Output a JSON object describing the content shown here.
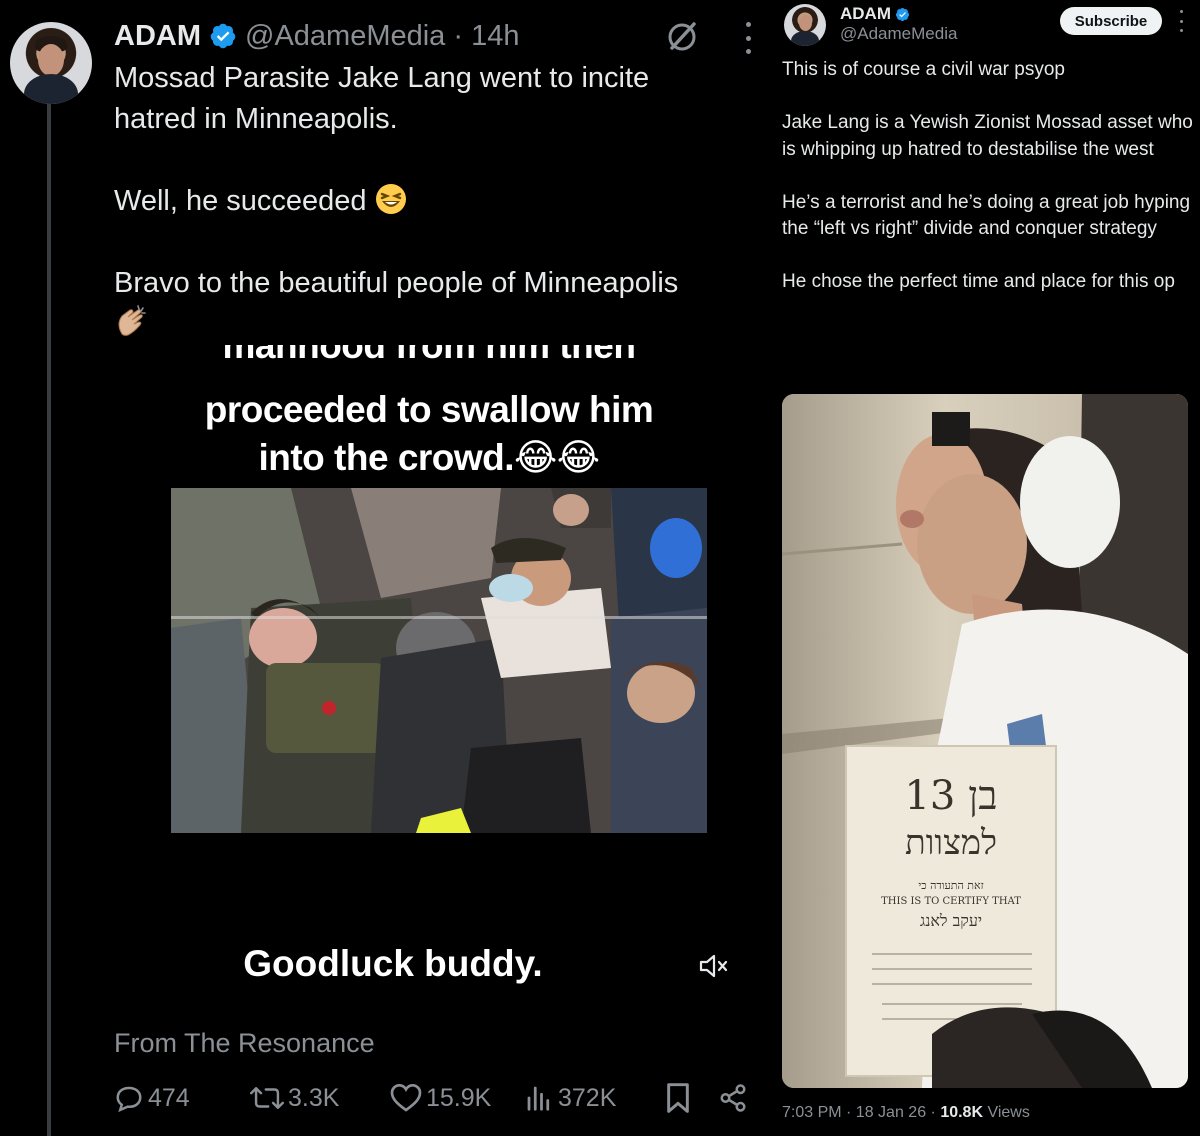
{
  "left_post": {
    "author_name": "ADAM",
    "handle_time": "@AdameMedia · 14h",
    "text_lines": [
      "Mossad Parasite Jake Lang went to incite",
      "hatred in Minneapolis.",
      "Well, he succeeded",
      "Bravo to the beautiful people of Minneapolis"
    ],
    "emoji_laugh": "grinning-squinting-face",
    "emoji_clap": "clapping-hands",
    "video": {
      "caption_line1": "manhood from him then",
      "caption_line2": "proceeded to swallow him",
      "caption_line3": "into the crowd.😂😂",
      "bottom_caption": "Goodluck buddy."
    },
    "source": "From The Resonance",
    "actions": {
      "replies": "474",
      "reposts": "3.3K",
      "likes": "15.9K",
      "views": "372K"
    }
  },
  "right_post": {
    "author_name": "ADAM",
    "handle": "@AdameMedia",
    "subscribe_label": "Subscribe",
    "paragraphs": [
      "This is of course a civil war psyop",
      "Jake Lang is a Yewish Zionist Mossad asset who is whipping up hatred to destabilise the west",
      "He’s a terrorist and he’s doing a great job hyping  the “left vs right” divide and conquer strategy",
      "He chose the perfect time and place for this op"
    ],
    "photo_sign": {
      "line1": "בן 13",
      "line2": "למצוות",
      "line3": "זאת התעודה כי",
      "line4": "THIS IS TO CERTIFY THAT",
      "line5": "יעקב לאנג"
    },
    "timestamp": "7:03 PM · 18 Jan 26 · ",
    "views_count": "10.8K",
    "views_label": " Views"
  },
  "colors": {
    "background": "#000000",
    "text_primary": "#e7e9ea",
    "text_secondary": "#8b9096",
    "verified_blue": "#1d9bf0"
  }
}
